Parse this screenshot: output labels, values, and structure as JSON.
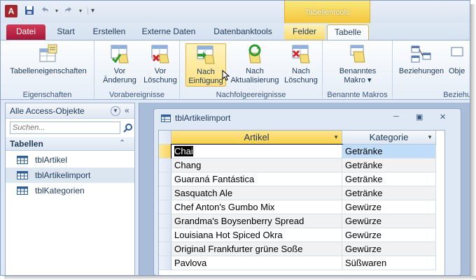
{
  "colors": {
    "file_tab": "#a3183a",
    "context_tab": "#f4c53a",
    "accent": "#1e395b",
    "selection": "#bfdcf8"
  },
  "titlebar": {
    "app_icon": "A",
    "qat": {
      "save_icon": "save-icon",
      "undo_icon": "undo-icon",
      "redo_icon": "redo-icon",
      "customize_icon": "customize-qat-icon"
    },
    "context_group": "Tabellentools"
  },
  "tabs": {
    "file": "Datei",
    "start": "Start",
    "create": "Erstellen",
    "external": "Externe Daten",
    "dbtools": "Datenbanktools",
    "fields": "Felder",
    "table": "Tabelle"
  },
  "ribbon": {
    "properties": {
      "button": "Tabelleneigenschaften",
      "group": "Eigenschaften"
    },
    "before_events": {
      "group": "Vorabereignisse",
      "before_change": [
        "Vor",
        "Änderung"
      ],
      "before_delete": [
        "Vor",
        "Löschung"
      ]
    },
    "after_events": {
      "group": "Nachfolgeereignisse",
      "after_insert": [
        "Nach",
        "Einfügung"
      ],
      "after_update": [
        "Nach",
        "Aktualisierung"
      ],
      "after_delete": [
        "Nach",
        "Löschung"
      ]
    },
    "named_macros": {
      "group": "Benannte Makros",
      "button": [
        "Benanntes",
        "Makro ▾"
      ]
    },
    "relationships": {
      "button1": "Beziehungen",
      "button2": "Obje",
      "group": "Beziehu"
    }
  },
  "nav": {
    "title": "Alle Access-Objekte",
    "search_placeholder": "Suchen...",
    "section": "Tabellen",
    "items": [
      "tblArtikel",
      "tblArtikelimport",
      "tblKategorien"
    ],
    "selected_index": 1
  },
  "document": {
    "title": "tblArtikelimport",
    "columns": [
      "Artikel",
      "Kategorie"
    ],
    "rows": [
      [
        "Chai",
        "Getränke"
      ],
      [
        "Chang",
        "Getränke"
      ],
      [
        "Guaraná Fantástica",
        "Getränke"
      ],
      [
        "Sasquatch Ale",
        "Getränke"
      ],
      [
        "Chef Anton's Gumbo Mix",
        "Gewürze"
      ],
      [
        "Grandma's Boysenberry Spread",
        "Gewürze"
      ],
      [
        "Louisiana Hot Spiced Okra",
        "Gewürze"
      ],
      [
        "Original Frankfurter grüne Soße",
        "Gewürze"
      ],
      [
        "Pavlova",
        "Süßwaren"
      ]
    ]
  }
}
